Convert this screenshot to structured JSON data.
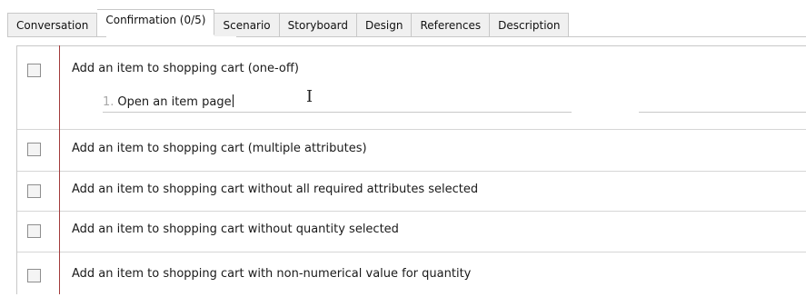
{
  "tabs": [
    {
      "label": "Conversation",
      "active": false
    },
    {
      "label": "Confirmation (0/5)",
      "active": true
    },
    {
      "label": "Scenario",
      "active": false
    },
    {
      "label": "Storyboard",
      "active": false
    },
    {
      "label": "Design",
      "active": false
    },
    {
      "label": "References",
      "active": false
    },
    {
      "label": "Description",
      "active": false
    }
  ],
  "confirmations": [
    {
      "label": "Add an item to shopping cart (one-off)",
      "checked": false
    },
    {
      "label": "Add an item to shopping cart (multiple attributes)",
      "checked": false
    },
    {
      "label": "Add an item to shopping cart without all required attributes selected",
      "checked": false
    },
    {
      "label": "Add an item to shopping cart without quantity selected",
      "checked": false
    },
    {
      "label": "Add an item to shopping cart with non-numerical value for quantity",
      "checked": false
    }
  ],
  "step": {
    "number": "1.",
    "text": "Open an item page"
  },
  "colors": {
    "divider_accent": "#a23b3b",
    "tab_bg": "#f0f0f0",
    "border": "#c8c8c8"
  },
  "icons": {
    "cursor": "text-cursor-icon"
  }
}
